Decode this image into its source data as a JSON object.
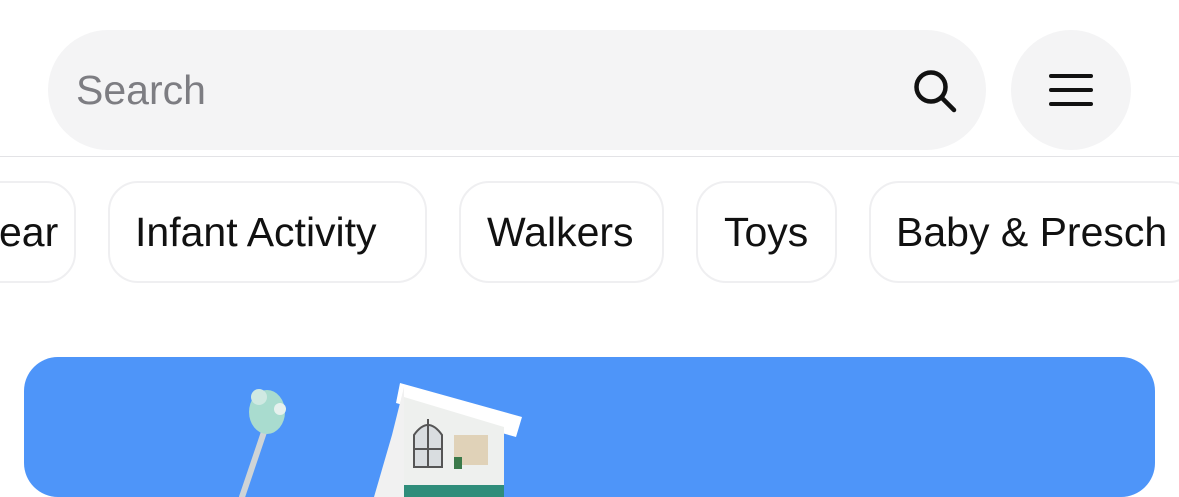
{
  "search": {
    "placeholder": "Search"
  },
  "categories": [
    {
      "label": "Gear",
      "visible_text": "ear"
    },
    {
      "label": "Infant Activity"
    },
    {
      "label": "Walkers"
    },
    {
      "label": "Toys"
    },
    {
      "label": "Baby & Presch",
      "visible_text": "Baby & Presch"
    }
  ],
  "icons": {
    "search": "search-icon",
    "menu": "hamburger-menu-icon"
  },
  "colors": {
    "search_bg": "#f4f4f5",
    "banner_bg": "#4e95f9",
    "chip_border": "#efeff1",
    "placeholder": "#7d7d82"
  }
}
